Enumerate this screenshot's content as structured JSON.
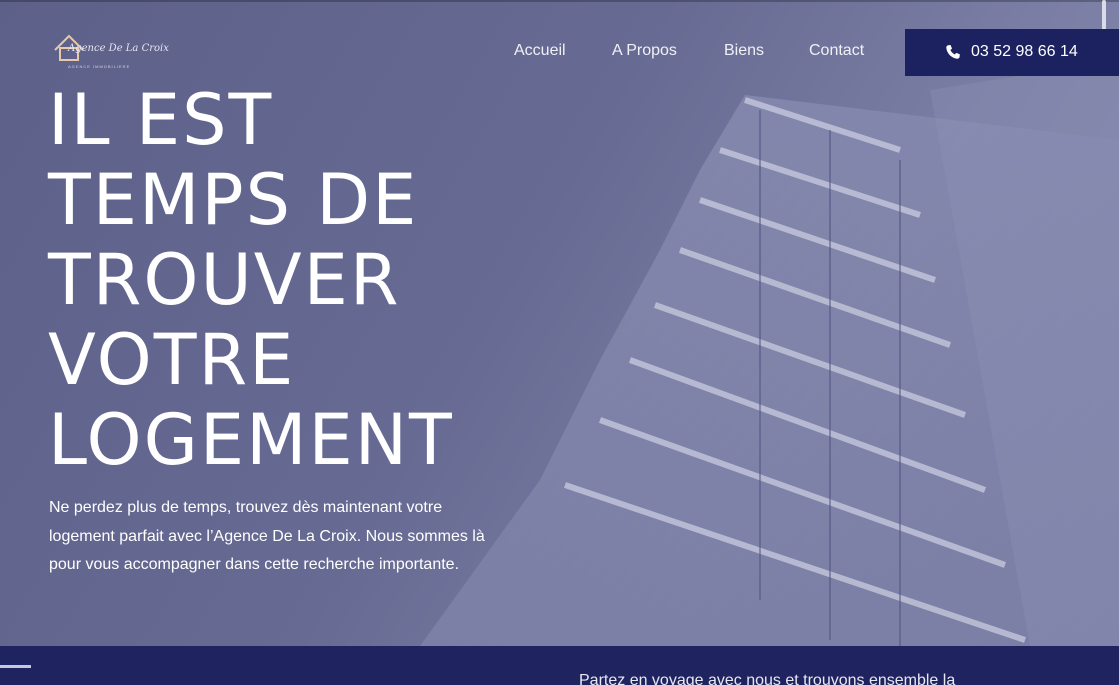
{
  "brand": {
    "logo_script": "Agence De La Croix",
    "logo_sub": "AGENCE IMMOBILIERE"
  },
  "nav": {
    "items": [
      {
        "label": "Accueil"
      },
      {
        "label": "A Propos"
      },
      {
        "label": "Biens"
      },
      {
        "label": "Contact"
      }
    ],
    "phone_label": "03 52 98 66 14"
  },
  "hero": {
    "headline_lines": [
      "IL EST",
      "TEMPS DE",
      "TROUVER",
      "VOTRE",
      "LOGEMENT"
    ],
    "description": "Ne perdez plus de temps, trouvez dès maintenant votre logement parfait avec l’Agence De La Croix. Nous sommes là pour vous accompagner dans cette recherche importante."
  },
  "bottom": {
    "teaser": "Partez en voyage avec nous et trouvons ensemble la"
  },
  "colors": {
    "overlay": "#5d6189",
    "button": "#1c2260",
    "band": "#1f2460",
    "text": "#ffffff"
  },
  "icons": {
    "phone": "phone-icon",
    "logo": "house-logo-icon"
  }
}
